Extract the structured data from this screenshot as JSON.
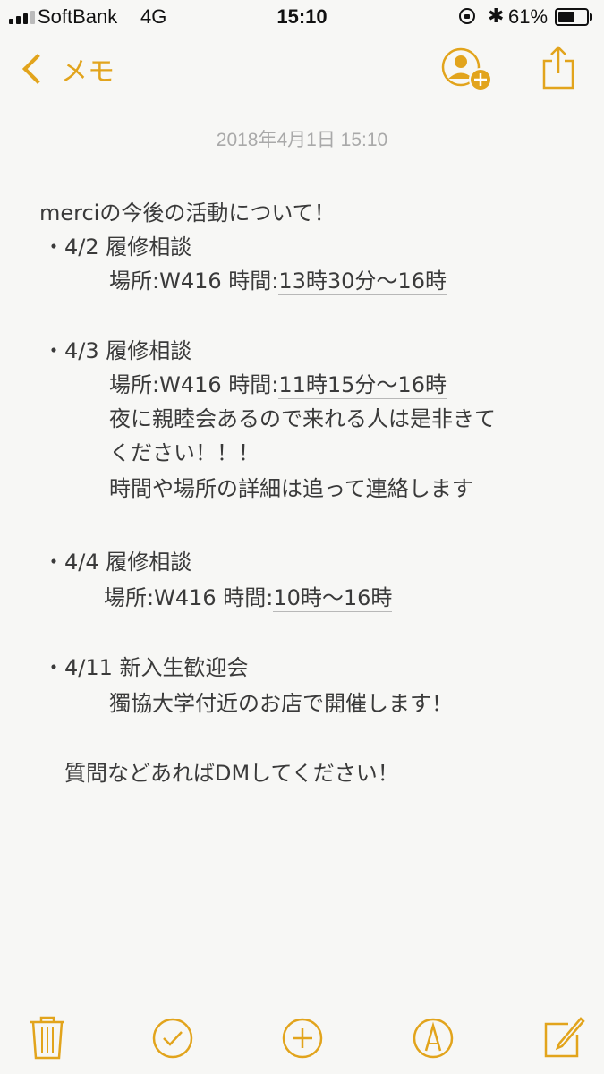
{
  "status_bar": {
    "carrier": "SoftBank",
    "network": "4G",
    "time": "15:10",
    "battery_percent": "61%",
    "battery_level": 0.61
  },
  "nav": {
    "back_label": "メモ",
    "accent_color": "#e2a41c"
  },
  "note": {
    "date": "2018年4月1日 15:10",
    "lines": {
      "title": "merciの今後の活動について！",
      "i1_head": "・4/2 履修相談",
      "i1_place": "場所:W416  時間:",
      "i1_time": "13時30分〜16時",
      "i2_head": "・4/3 履修相談",
      "i2_place": "場所:W416  時間:",
      "i2_time": "11時15分〜16時",
      "i2_note1": "夜に親睦会あるので来れる人は是非きて",
      "i2_note2": "ください！！！",
      "i2_note3": "時間や場所の詳細は追って連絡します",
      "i3_head": "・4/4 履修相談",
      "i3_place": "場所:W416  時間:",
      "i3_time": "10時〜16時",
      "i4_head": "・4/11 新入生歓迎会",
      "i4_note": "獨協大学付近のお店で開催します！",
      "closing": "質問などあればDMしてください！"
    }
  },
  "toolbar": {
    "icons": [
      "trash-icon",
      "checklist-icon",
      "add-icon",
      "sketch-icon",
      "compose-icon"
    ]
  }
}
